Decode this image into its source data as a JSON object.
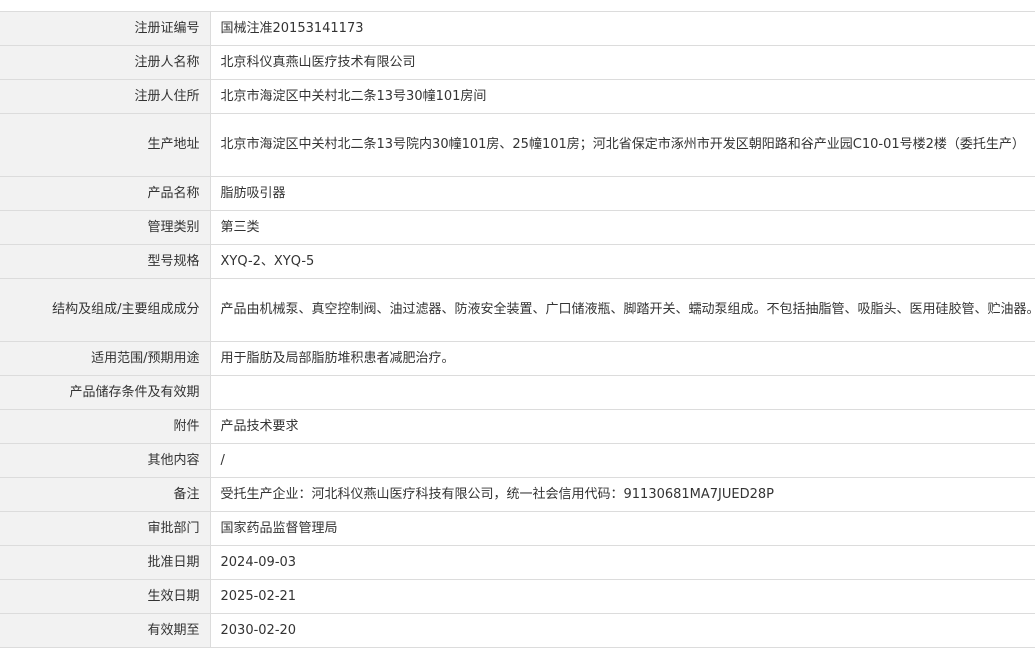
{
  "rows": [
    {
      "label": "注册证编号",
      "value": "国械注准20153141173"
    },
    {
      "label": "注册人名称",
      "value": "北京科仪真燕山医疗技术有限公司"
    },
    {
      "label": "注册人住所",
      "value": "北京市海淀区中关村北二条13号30幢101房间"
    },
    {
      "label": "生产地址",
      "value": "北京市海淀区中关村北二条13号院内30幢101房、25幢101房；河北省保定市涿州市开发区朝阳路和谷产业园C10-01号楼2楼（委托生产）"
    },
    {
      "label": "产品名称",
      "value": "脂肪吸引器"
    },
    {
      "label": "管理类别",
      "value": "第三类"
    },
    {
      "label": "型号规格",
      "value": "XYQ-2、XYQ-5"
    },
    {
      "label": "结构及组成/主要组成成分",
      "value": "产品由机械泵、真空控制阀、油过滤器、防液安全装置、广口储液瓶、脚踏开关、蠕动泵组成。不包括抽脂管、吸脂头、医用硅胶管、贮油器。"
    },
    {
      "label": "适用范围/预期用途",
      "value": "用于脂肪及局部脂肪堆积患者减肥治疗。"
    },
    {
      "label": "产品储存条件及有效期",
      "value": ""
    },
    {
      "label": "附件",
      "value": "产品技术要求"
    },
    {
      "label": "其他内容",
      "value": "/"
    },
    {
      "label": "备注",
      "value": "受托生产企业：河北科仪燕山医疗科技有限公司，统一社会信用代码：91130681MA7JUED28P"
    },
    {
      "label": "审批部门",
      "value": "国家药品监督管理局"
    },
    {
      "label": "批准日期",
      "value": "2024-09-03"
    },
    {
      "label": "生效日期",
      "value": "2025-02-21"
    },
    {
      "label": "有效期至",
      "value": "2030-02-20"
    }
  ]
}
